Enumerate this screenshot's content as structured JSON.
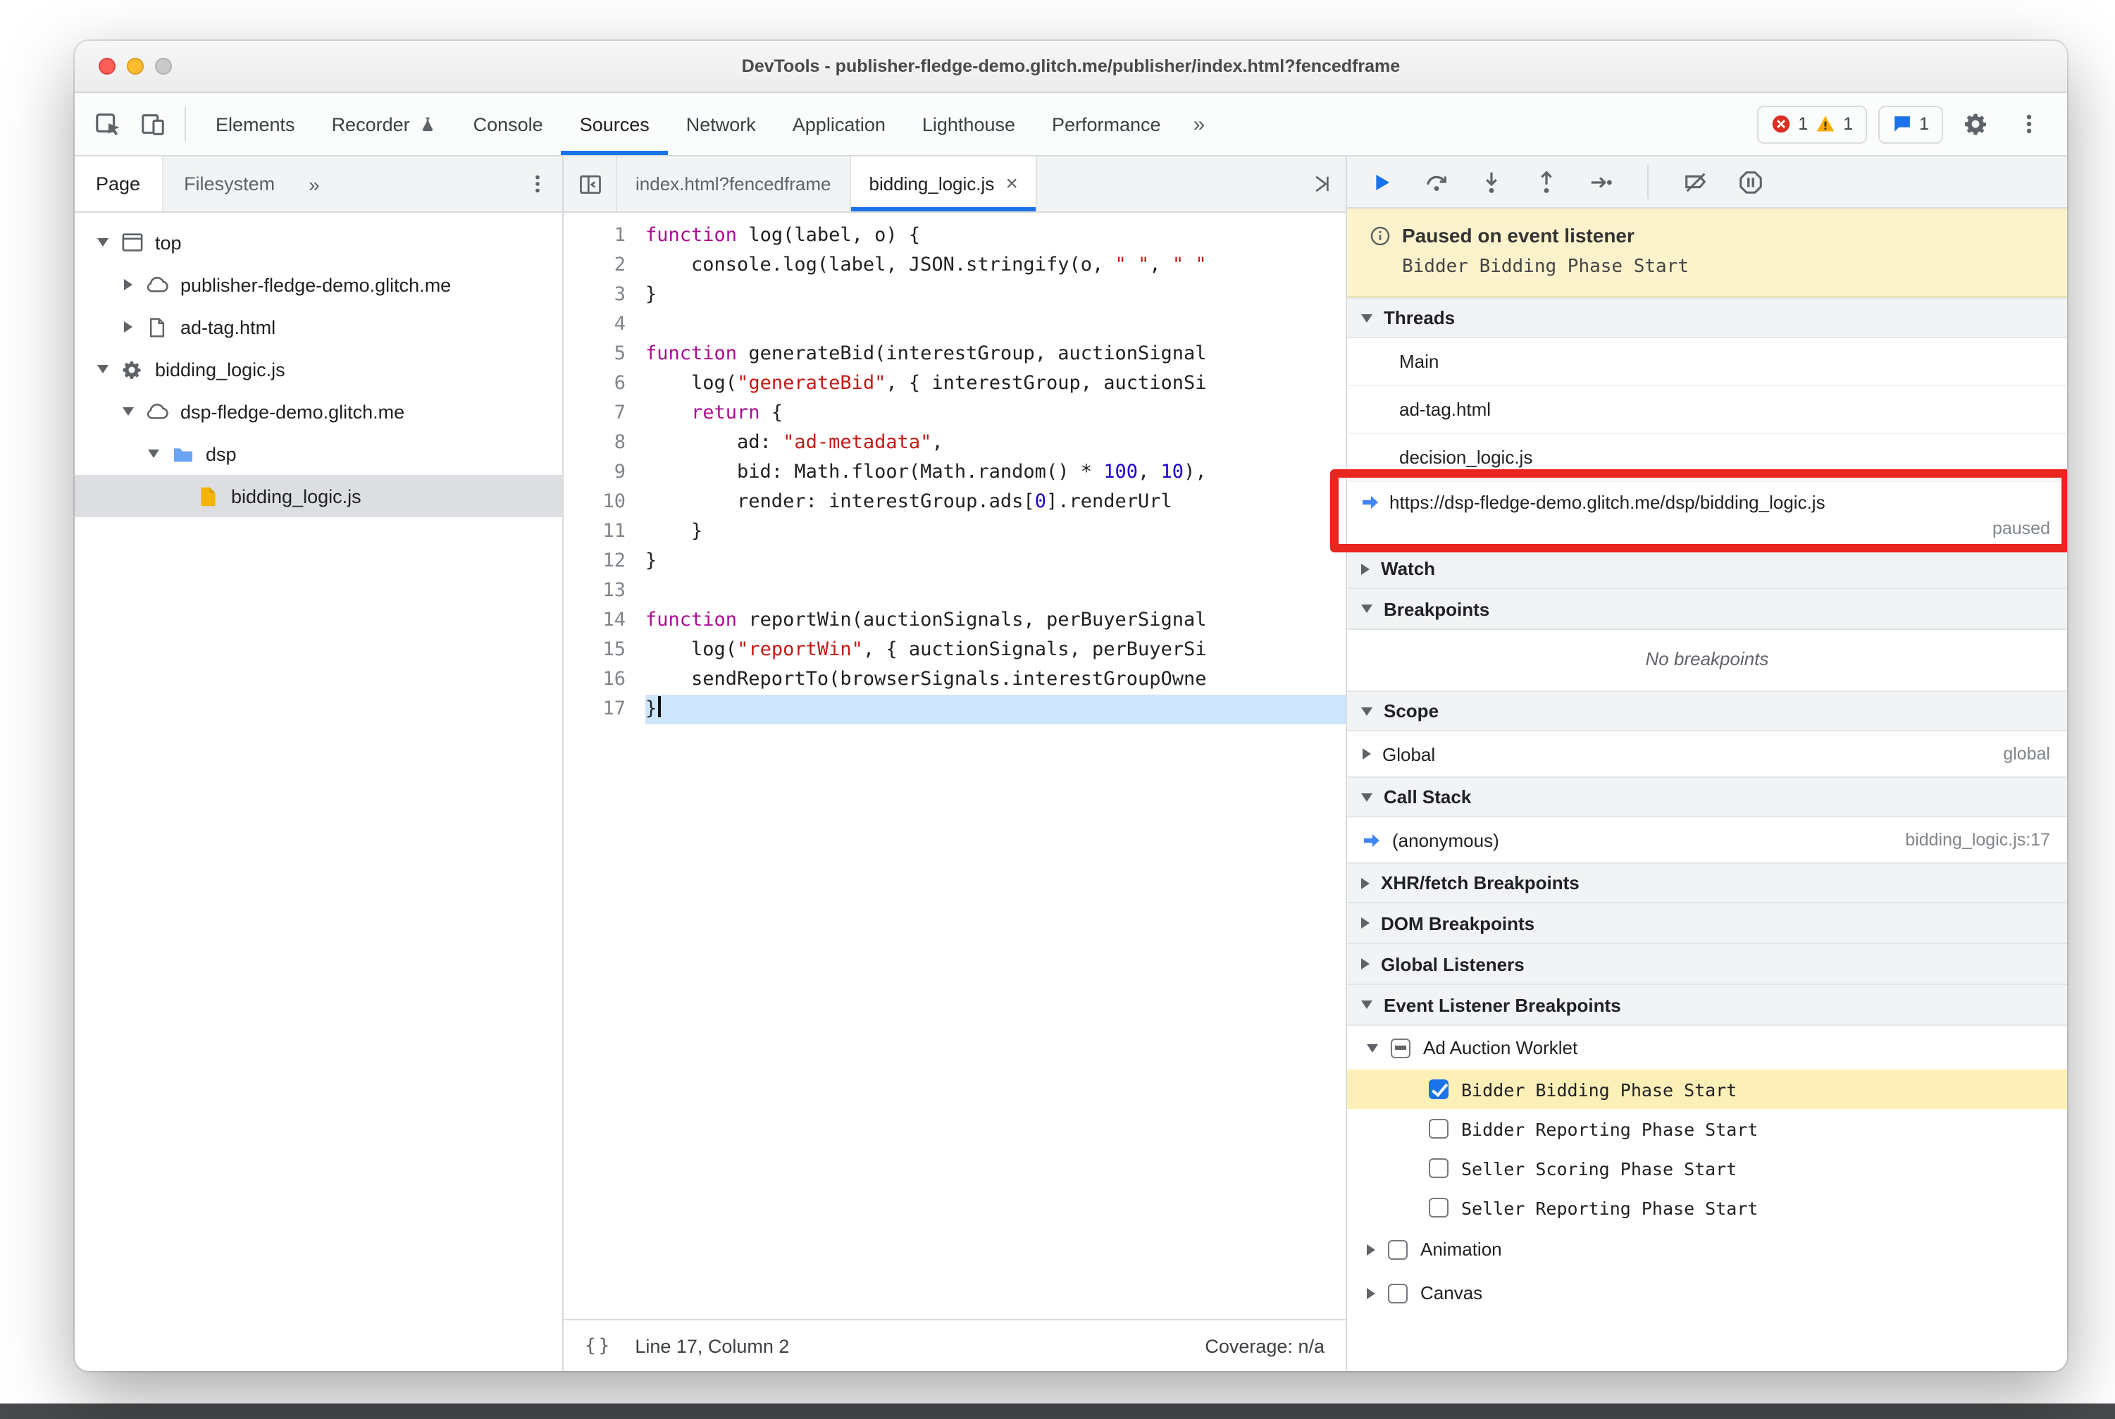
{
  "window": {
    "title": "DevTools - publisher-fledge-demo.glitch.me/publisher/index.html?fencedframe"
  },
  "toolbar": {
    "tabs": [
      {
        "label": "Elements",
        "selected": false
      },
      {
        "label": "Recorder",
        "selected": false,
        "experimental": true
      },
      {
        "label": "Console",
        "selected": false
      },
      {
        "label": "Sources",
        "selected": true
      },
      {
        "label": "Network",
        "selected": false
      },
      {
        "label": "Application",
        "selected": false
      },
      {
        "label": "Lighthouse",
        "selected": false
      },
      {
        "label": "Performance",
        "selected": false
      }
    ],
    "more_tabs_label": "»",
    "error_count": "1",
    "warning_count": "1",
    "issues_count": "1"
  },
  "sidebar": {
    "tabs": [
      {
        "label": "Page",
        "selected": true
      },
      {
        "label": "Filesystem",
        "selected": false
      }
    ],
    "more_label": "»",
    "tree": [
      {
        "label": "top",
        "state": "expanded",
        "icon": "frame-icon"
      },
      {
        "label": "publisher-fledge-demo.glitch.me",
        "state": "collapsed",
        "icon": "cloud-icon"
      },
      {
        "label": "ad-tag.html",
        "state": "collapsed",
        "icon": "document-icon"
      },
      {
        "label": "bidding_logic.js",
        "state": "expanded",
        "icon": "worklet-gear-icon"
      },
      {
        "label": "dsp-fledge-demo.glitch.me",
        "state": "expanded",
        "icon": "cloud-icon"
      },
      {
        "label": "dsp",
        "state": "expanded",
        "icon": "folder-icon"
      },
      {
        "label": "bidding_logic.js",
        "state": "leaf",
        "icon": "js-file-icon",
        "selected": true
      }
    ]
  },
  "editor": {
    "tabs": [
      {
        "label": "index.html?fencedframe",
        "selected": false
      },
      {
        "label": "bidding_logic.js",
        "selected": true,
        "close": "×"
      }
    ],
    "code": [
      {
        "n": "1",
        "seg": [
          [
            "k",
            "function"
          ],
          [
            "p",
            " log(label, o) {"
          ]
        ]
      },
      {
        "n": "2",
        "seg": [
          [
            "p",
            "    console.log(label, JSON.stringify(o, "
          ],
          [
            "s",
            "\" \""
          ],
          [
            "p",
            ", "
          ],
          [
            "s",
            "\" \""
          ]
        ]
      },
      {
        "n": "3",
        "seg": [
          [
            "p",
            "}"
          ]
        ]
      },
      {
        "n": "4",
        "seg": []
      },
      {
        "n": "5",
        "seg": [
          [
            "k",
            "function"
          ],
          [
            "p",
            " generateBid(interestGroup, auctionSignal"
          ]
        ]
      },
      {
        "n": "6",
        "seg": [
          [
            "p",
            "    log("
          ],
          [
            "s",
            "\"generateBid\""
          ],
          [
            "p",
            ", { interestGroup, auctionSi"
          ]
        ]
      },
      {
        "n": "7",
        "seg": [
          [
            "p",
            "    "
          ],
          [
            "k",
            "return"
          ],
          [
            "p",
            " {"
          ]
        ]
      },
      {
        "n": "8",
        "seg": [
          [
            "p",
            "        ad: "
          ],
          [
            "s",
            "\"ad-metadata\""
          ],
          [
            "p",
            ","
          ]
        ]
      },
      {
        "n": "9",
        "seg": [
          [
            "p",
            "        bid: Math.floor(Math.random() * "
          ],
          [
            "n2",
            "100"
          ],
          [
            "p",
            ", "
          ],
          [
            "n2",
            "10"
          ],
          [
            "p",
            "),"
          ]
        ]
      },
      {
        "n": "10",
        "seg": [
          [
            "p",
            "        render: interestGroup.ads["
          ],
          [
            "n2",
            "0"
          ],
          [
            "p",
            "].renderUrl"
          ]
        ]
      },
      {
        "n": "11",
        "seg": [
          [
            "p",
            "    }"
          ]
        ]
      },
      {
        "n": "12",
        "seg": [
          [
            "p",
            "}"
          ]
        ]
      },
      {
        "n": "13",
        "seg": []
      },
      {
        "n": "14",
        "seg": [
          [
            "k",
            "function"
          ],
          [
            "p",
            " reportWin(auctionSignals, perBuyerSignal"
          ]
        ]
      },
      {
        "n": "15",
        "seg": [
          [
            "p",
            "    log("
          ],
          [
            "s",
            "\"reportWin\""
          ],
          [
            "p",
            ", { auctionSignals, perBuyerSi"
          ]
        ]
      },
      {
        "n": "16",
        "seg": [
          [
            "p",
            "    sendReportTo(browserSignals.interestGroupOwne"
          ]
        ]
      },
      {
        "n": "17",
        "seg": [
          [
            "p",
            "}"
          ]
        ],
        "paused": true
      }
    ],
    "statusbar": {
      "pretty_print": "{}",
      "position": "Line 17, Column 2",
      "coverage": "Coverage: n/a"
    }
  },
  "debugger": {
    "paused_banner": {
      "title": "Paused on event listener",
      "subtitle": "Bidder Bidding Phase Start"
    },
    "threads": {
      "title": "Threads",
      "items": [
        {
          "label": "Main"
        },
        {
          "label": "ad-tag.html"
        },
        {
          "label": "decision_logic.js"
        },
        {
          "label": "https://dsp-fledge-demo.glitch.me/dsp/bidding_logic.js",
          "active": true,
          "note": "paused"
        }
      ]
    },
    "watch": {
      "title": "Watch"
    },
    "breakpoints": {
      "title": "Breakpoints",
      "empty_text": "No breakpoints"
    },
    "scope": {
      "title": "Scope",
      "rows": [
        {
          "label": "Global",
          "value": "global"
        }
      ]
    },
    "call_stack": {
      "title": "Call Stack",
      "rows": [
        {
          "label": "(anonymous)",
          "location": "bidding_logic.js:17",
          "active": true
        }
      ]
    },
    "xhr_breakpoints": {
      "title": "XHR/fetch Breakpoints"
    },
    "dom_breakpoints": {
      "title": "DOM Breakpoints"
    },
    "global_listeners": {
      "title": "Global Listeners"
    },
    "event_listener_breakpoints": {
      "title": "Event Listener Breakpoints",
      "categories": [
        {
          "label": "Ad Auction Worklet",
          "state": "expanded",
          "checkbox": "indeterminate",
          "events": [
            {
              "label": "Bidder Bidding Phase Start",
              "checked": true,
              "highlighted": true
            },
            {
              "label": "Bidder Reporting Phase Start",
              "checked": false
            },
            {
              "label": "Seller Scoring Phase Start",
              "checked": false
            },
            {
              "label": "Seller Reporting Phase Start",
              "checked": false
            }
          ]
        },
        {
          "label": "Animation",
          "state": "collapsed",
          "checkbox": "unchecked",
          "events": []
        },
        {
          "label": "Canvas",
          "state": "collapsed",
          "checkbox": "unchecked",
          "events": []
        }
      ]
    }
  }
}
